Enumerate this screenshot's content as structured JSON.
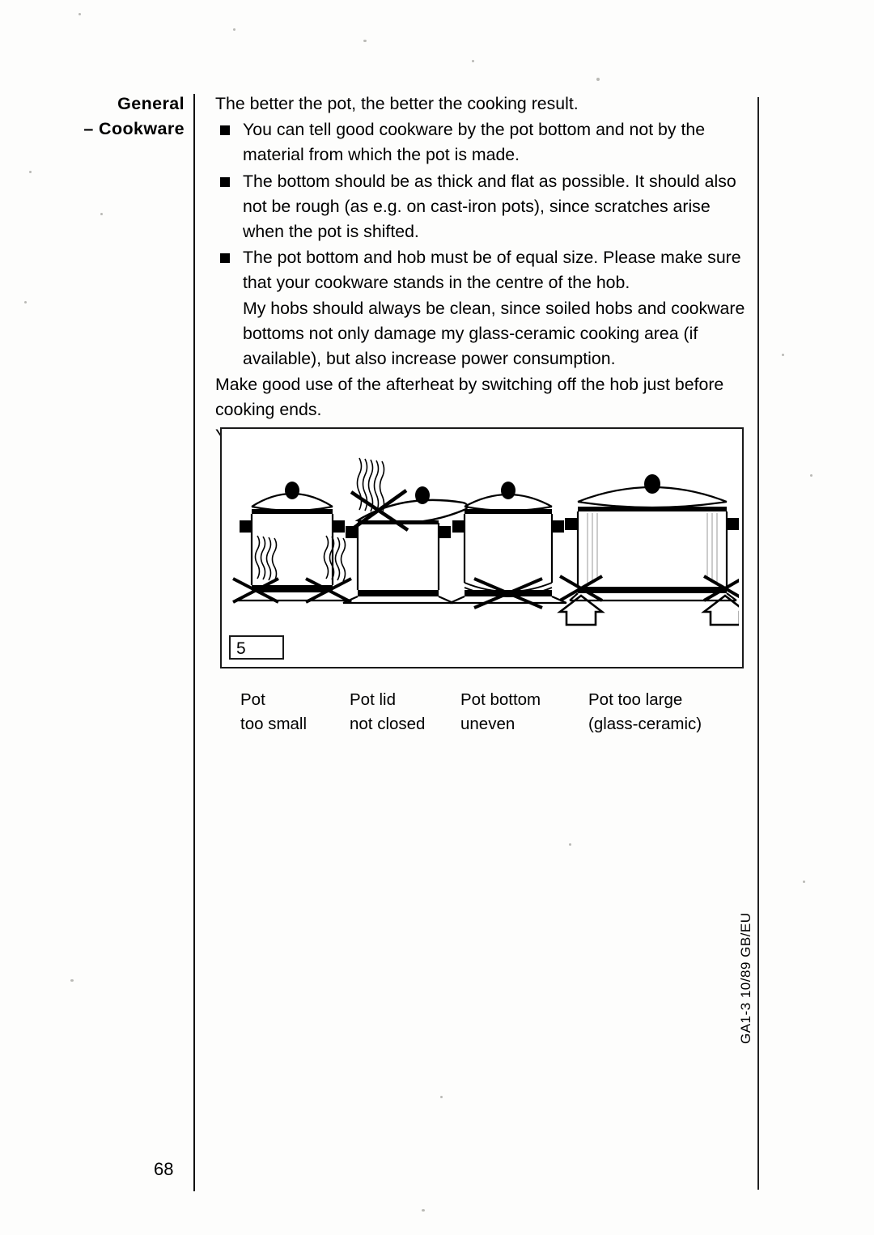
{
  "header": {
    "line1": "General",
    "line2": "– Cookware"
  },
  "body": {
    "lead": "The better the pot, the better the cooking result.",
    "bullets": [
      "You can tell good cookware by the pot bottom and not by the material from which the pot is made.",
      "The bottom should be as thick and flat as possible. It should also not be rough (as e.g. on cast-iron pots), since scratches arise when the pot is shifted.",
      "The pot bottom and hob must be of equal size. Please make sure that your cookware stands in the centre of the hob."
    ],
    "continuation": "My hobs should always be clean, since soiled hobs and cookware bottoms not only damage my glass-ceramic cooking area (if available), but also increase power consumption.",
    "tail1": "Make good use of the afterheat by switching off the hob just before cooking ends.",
    "tail2": "You waste energy e.g. if . . ."
  },
  "figure": {
    "number": "5",
    "captions": [
      "Pot\ntoo small",
      "Pot lid\nnot closed",
      "Pot bottom\nuneven",
      "Pot too large\n(glass-ceramic)"
    ]
  },
  "footer": {
    "page_number": "68",
    "side_code": "GA1-3 10/89   GB/EU"
  },
  "colors": {
    "ink": "#000000",
    "paper": "#fdfdfc",
    "rule": "#111111"
  }
}
